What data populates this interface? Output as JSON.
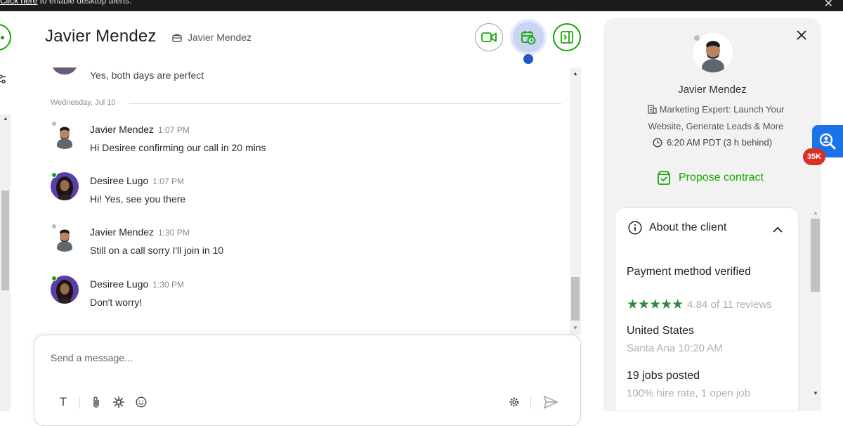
{
  "notification_bar": {
    "text": "to enable desktop alerts.",
    "link": "Click here"
  },
  "header": {
    "name": "Javier Mendez",
    "job_label": "Javier Mendez"
  },
  "chat": {
    "previous_message": "Yes, both days are perfect",
    "date_separator": "Wednesday, Jul 10",
    "messages": [
      {
        "name": "Javier Mendez",
        "time": "1:07 PM",
        "text": "Hi Desiree confirming our call in 20 mins"
      },
      {
        "name": "Desiree Lugo",
        "time": "1:07 PM",
        "text": "Hi! Yes, see you there"
      },
      {
        "name": "Javier Mendez",
        "time": "1:30 PM",
        "text": "Still on a call sorry I'll join in 10"
      },
      {
        "name": "Desiree Lugo",
        "time": "1:30 PM",
        "text": "Don't worry!"
      }
    ]
  },
  "composer": {
    "placeholder": "Send a message..."
  },
  "profile_panel": {
    "name": "Javier Mendez",
    "title": "Marketing Expert: Launch Your Website, Generate Leads & More",
    "local_time": "6:20 AM PDT (3 h behind)",
    "propose_contract": "Propose contract",
    "about": {
      "heading": "About the client",
      "payment": "Payment method verified",
      "rating": 4.84,
      "rating_text": "4.84 of 11 reviews",
      "country": "United States",
      "city_time": "Santa Ana 10:20 AM",
      "jobs_posted": "19 jobs posted",
      "hire_rate": "100% hire rate, 1 open job"
    }
  },
  "extension": {
    "badge": "35K"
  },
  "colors": {
    "brand_green": "#14a800",
    "accent_blue": "#1f57c3",
    "star_green": "#2a8a3e"
  }
}
